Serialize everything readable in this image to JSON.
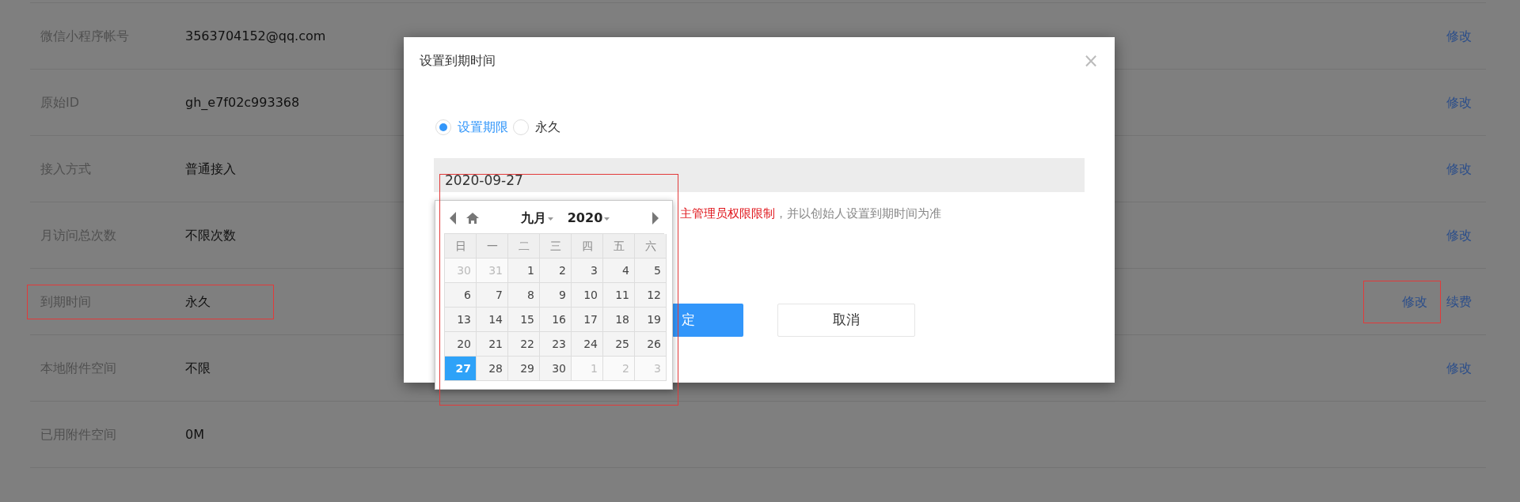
{
  "rows": [
    {
      "label": "微信小程序帐号",
      "value": "3563704152@qq.com",
      "highlighted": false,
      "actions": [
        {
          "text": "修改",
          "highlighted": false
        }
      ]
    },
    {
      "label": "原始ID",
      "value": "gh_e7f02c993368",
      "highlighted": false,
      "actions": [
        {
          "text": "修改",
          "highlighted": false
        }
      ]
    },
    {
      "label": "接入方式",
      "value": "普通接入",
      "highlighted": false,
      "actions": [
        {
          "text": "修改",
          "highlighted": false
        }
      ]
    },
    {
      "label": "月访问总次数",
      "value": "不限次数",
      "highlighted": false,
      "actions": [
        {
          "text": "修改",
          "highlighted": false
        }
      ]
    },
    {
      "label": "到期时间",
      "value": "永久",
      "highlighted": true,
      "actions": [
        {
          "text": "修改",
          "highlighted": true
        },
        {
          "text": "续费",
          "highlighted": false
        }
      ]
    },
    {
      "label": "本地附件空间",
      "value": "不限",
      "highlighted": false,
      "actions": [
        {
          "text": "修改",
          "highlighted": false
        }
      ]
    },
    {
      "label": "已用附件空间",
      "value": "0M",
      "highlighted": false,
      "actions": []
    }
  ],
  "dialog": {
    "title": "设置到期时间",
    "close": "×",
    "options": [
      {
        "label": "设置期限",
        "selected": true
      },
      {
        "label": "永久",
        "selected": false
      }
    ],
    "date_field": {
      "value": "2020-09-27"
    },
    "hint": {
      "warning": "主管理员权限限制",
      "text": "，并以创始人设置到期时间为准"
    },
    "buttons": [
      {
        "label": "定",
        "kind": "primary"
      },
      {
        "label": "取消",
        "kind": "default"
      }
    ]
  },
  "date_picker": {
    "highlighted": true,
    "month": "九月",
    "year": "2020",
    "weekdays": [
      "日",
      "一",
      "二",
      "三",
      "四",
      "五",
      "六"
    ],
    "weeks": [
      [
        {
          "day": "30",
          "outside": true,
          "selected": false
        },
        {
          "day": "31",
          "outside": true,
          "selected": false
        },
        {
          "day": "1",
          "outside": false,
          "selected": false
        },
        {
          "day": "2",
          "outside": false,
          "selected": false
        },
        {
          "day": "3",
          "outside": false,
          "selected": false
        },
        {
          "day": "4",
          "outside": false,
          "selected": false
        },
        {
          "day": "5",
          "outside": false,
          "selected": false
        }
      ],
      [
        {
          "day": "6",
          "outside": false,
          "selected": false
        },
        {
          "day": "7",
          "outside": false,
          "selected": false
        },
        {
          "day": "8",
          "outside": false,
          "selected": false
        },
        {
          "day": "9",
          "outside": false,
          "selected": false
        },
        {
          "day": "10",
          "outside": false,
          "selected": false
        },
        {
          "day": "11",
          "outside": false,
          "selected": false
        },
        {
          "day": "12",
          "outside": false,
          "selected": false
        }
      ],
      [
        {
          "day": "13",
          "outside": false,
          "selected": false
        },
        {
          "day": "14",
          "outside": false,
          "selected": false
        },
        {
          "day": "15",
          "outside": false,
          "selected": false
        },
        {
          "day": "16",
          "outside": false,
          "selected": false
        },
        {
          "day": "17",
          "outside": false,
          "selected": false
        },
        {
          "day": "18",
          "outside": false,
          "selected": false
        },
        {
          "day": "19",
          "outside": false,
          "selected": false
        }
      ],
      [
        {
          "day": "20",
          "outside": false,
          "selected": false
        },
        {
          "day": "21",
          "outside": false,
          "selected": false
        },
        {
          "day": "22",
          "outside": false,
          "selected": false
        },
        {
          "day": "23",
          "outside": false,
          "selected": false
        },
        {
          "day": "24",
          "outside": false,
          "selected": false
        },
        {
          "day": "25",
          "outside": false,
          "selected": false
        },
        {
          "day": "26",
          "outside": false,
          "selected": false
        }
      ],
      [
        {
          "day": "27",
          "outside": false,
          "selected": true
        },
        {
          "day": "28",
          "outside": false,
          "selected": false
        },
        {
          "day": "29",
          "outside": false,
          "selected": false
        },
        {
          "day": "30",
          "outside": false,
          "selected": false
        },
        {
          "day": "1",
          "outside": true,
          "selected": false
        },
        {
          "day": "2",
          "outside": true,
          "selected": false
        },
        {
          "day": "3",
          "outside": true,
          "selected": false
        }
      ]
    ]
  }
}
